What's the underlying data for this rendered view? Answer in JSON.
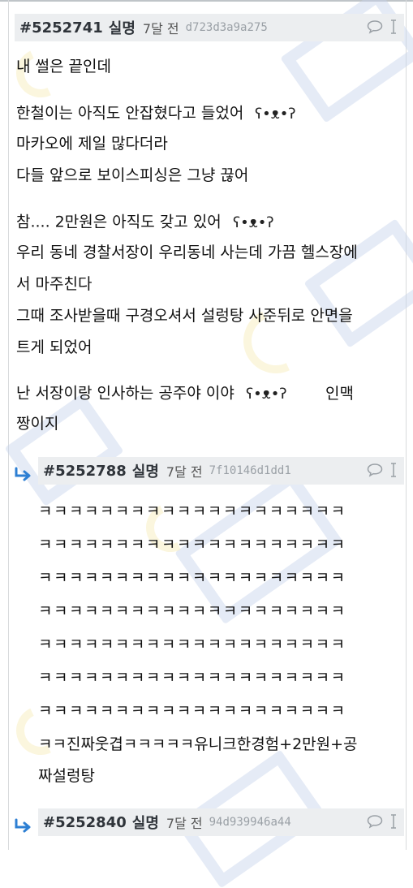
{
  "post": {
    "id": "#5252741",
    "author": "실명",
    "time": "7달 전",
    "hash": "d723d3a9a275",
    "lines": [
      "내 썰은 끝인데",
      "한철이는 아직도 안잡혔다고 들었어",
      "마카오에 제일 많다더라",
      "다들 앞으로 보이스피싱은 그냥 끊어",
      "참.... 2만원은 아직도 갖고 있어",
      "우리 동네 경찰서장이 우리동네 사는데 가끔 헬스장에",
      "서 마주친다",
      "그때 조사받을때 구경오셔서 설렁탕 사준뒤로 안면을",
      "트게 되었어",
      "난 서장이랑 인사하는 공주야 이야",
      "짱이지"
    ],
    "inline_after_emoticon": "인맥"
  },
  "replies": [
    {
      "id": "#5252788",
      "author": "실명",
      "time": "7달 전",
      "hash": "7f10146d1dd1",
      "lines": [
        "ㅋㅋㅋㅋㅋㅋㅋㅋㅋㅋㅋㅋㅋㅋㅋㅋㅋㅋㅋㅋ",
        "ㅋㅋㅋㅋㅋㅋㅋㅋㅋㅋㅋㅋㅋㅋㅋㅋㅋㅋㅋㅋ",
        "ㅋㅋㅋㅋㅋㅋㅋㅋㅋㅋㅋㅋㅋㅋㅋㅋㅋㅋㅋㅋ",
        "ㅋㅋㅋㅋㅋㅋㅋㅋㅋㅋㅋㅋㅋㅋㅋㅋㅋㅋㅋㅋ",
        "ㅋㅋㅋㅋㅋㅋㅋㅋㅋㅋㅋㅋㅋㅋㅋㅋㅋㅋㅋㅋ",
        "ㅋㅋㅋㅋㅋㅋㅋㅋㅋㅋㅋㅋㅋㅋㅋㅋㅋㅋㅋㅋ",
        "ㅋㅋㅋㅋㅋㅋㅋㅋㅋㅋㅋㅋㅋㅋㅋㅋㅋㅋㅋㅋ",
        "ㅋㅋ진짜웃겹ㅋㅋㅋㅋㅋ유니크한경험+2만원+공",
        "짜설렁탕"
      ]
    },
    {
      "id": "#5252840",
      "author": "실명",
      "time": "7달 전",
      "hash": "94d939946a44",
      "lines": []
    }
  ],
  "icons": {
    "comment": "speech-bubble-icon",
    "cursor": "text-cursor-icon",
    "reply": "reply-arrow-icon"
  },
  "colors": {
    "header_bg": "#eceef0",
    "reply_arrow": "#2d7fd3",
    "hash": "#9aa0a6"
  }
}
